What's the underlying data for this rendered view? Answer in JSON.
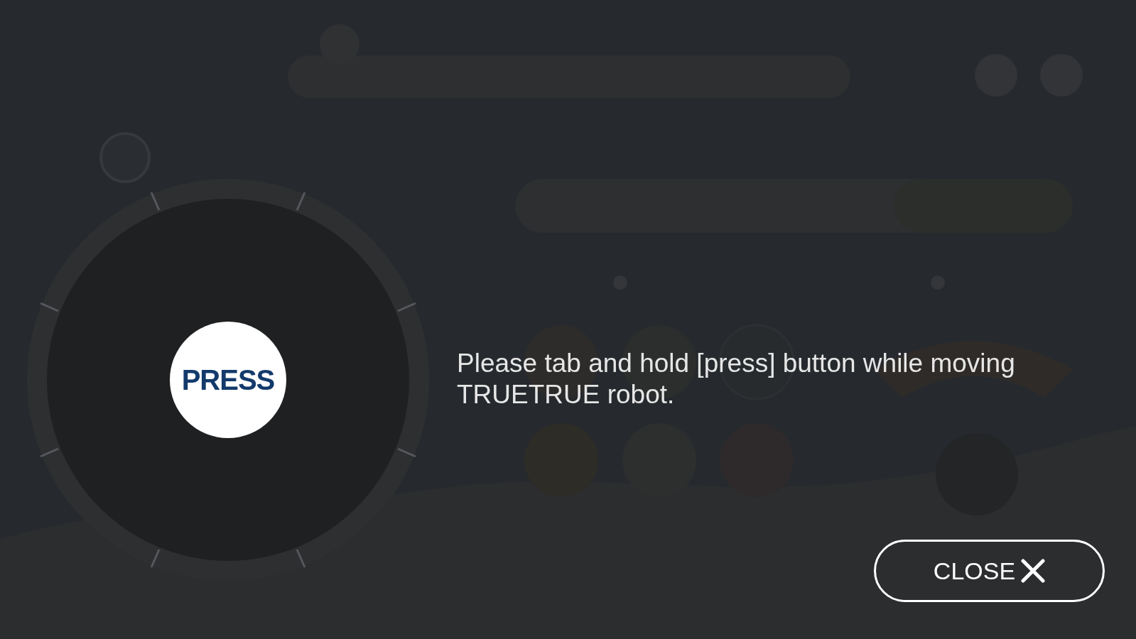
{
  "joystick": {
    "button_label": "PRESS"
  },
  "instruction": "Please tab and hold [press] button while moving TRUETRUE robot.",
  "close_button": {
    "label": "CLOSE"
  }
}
